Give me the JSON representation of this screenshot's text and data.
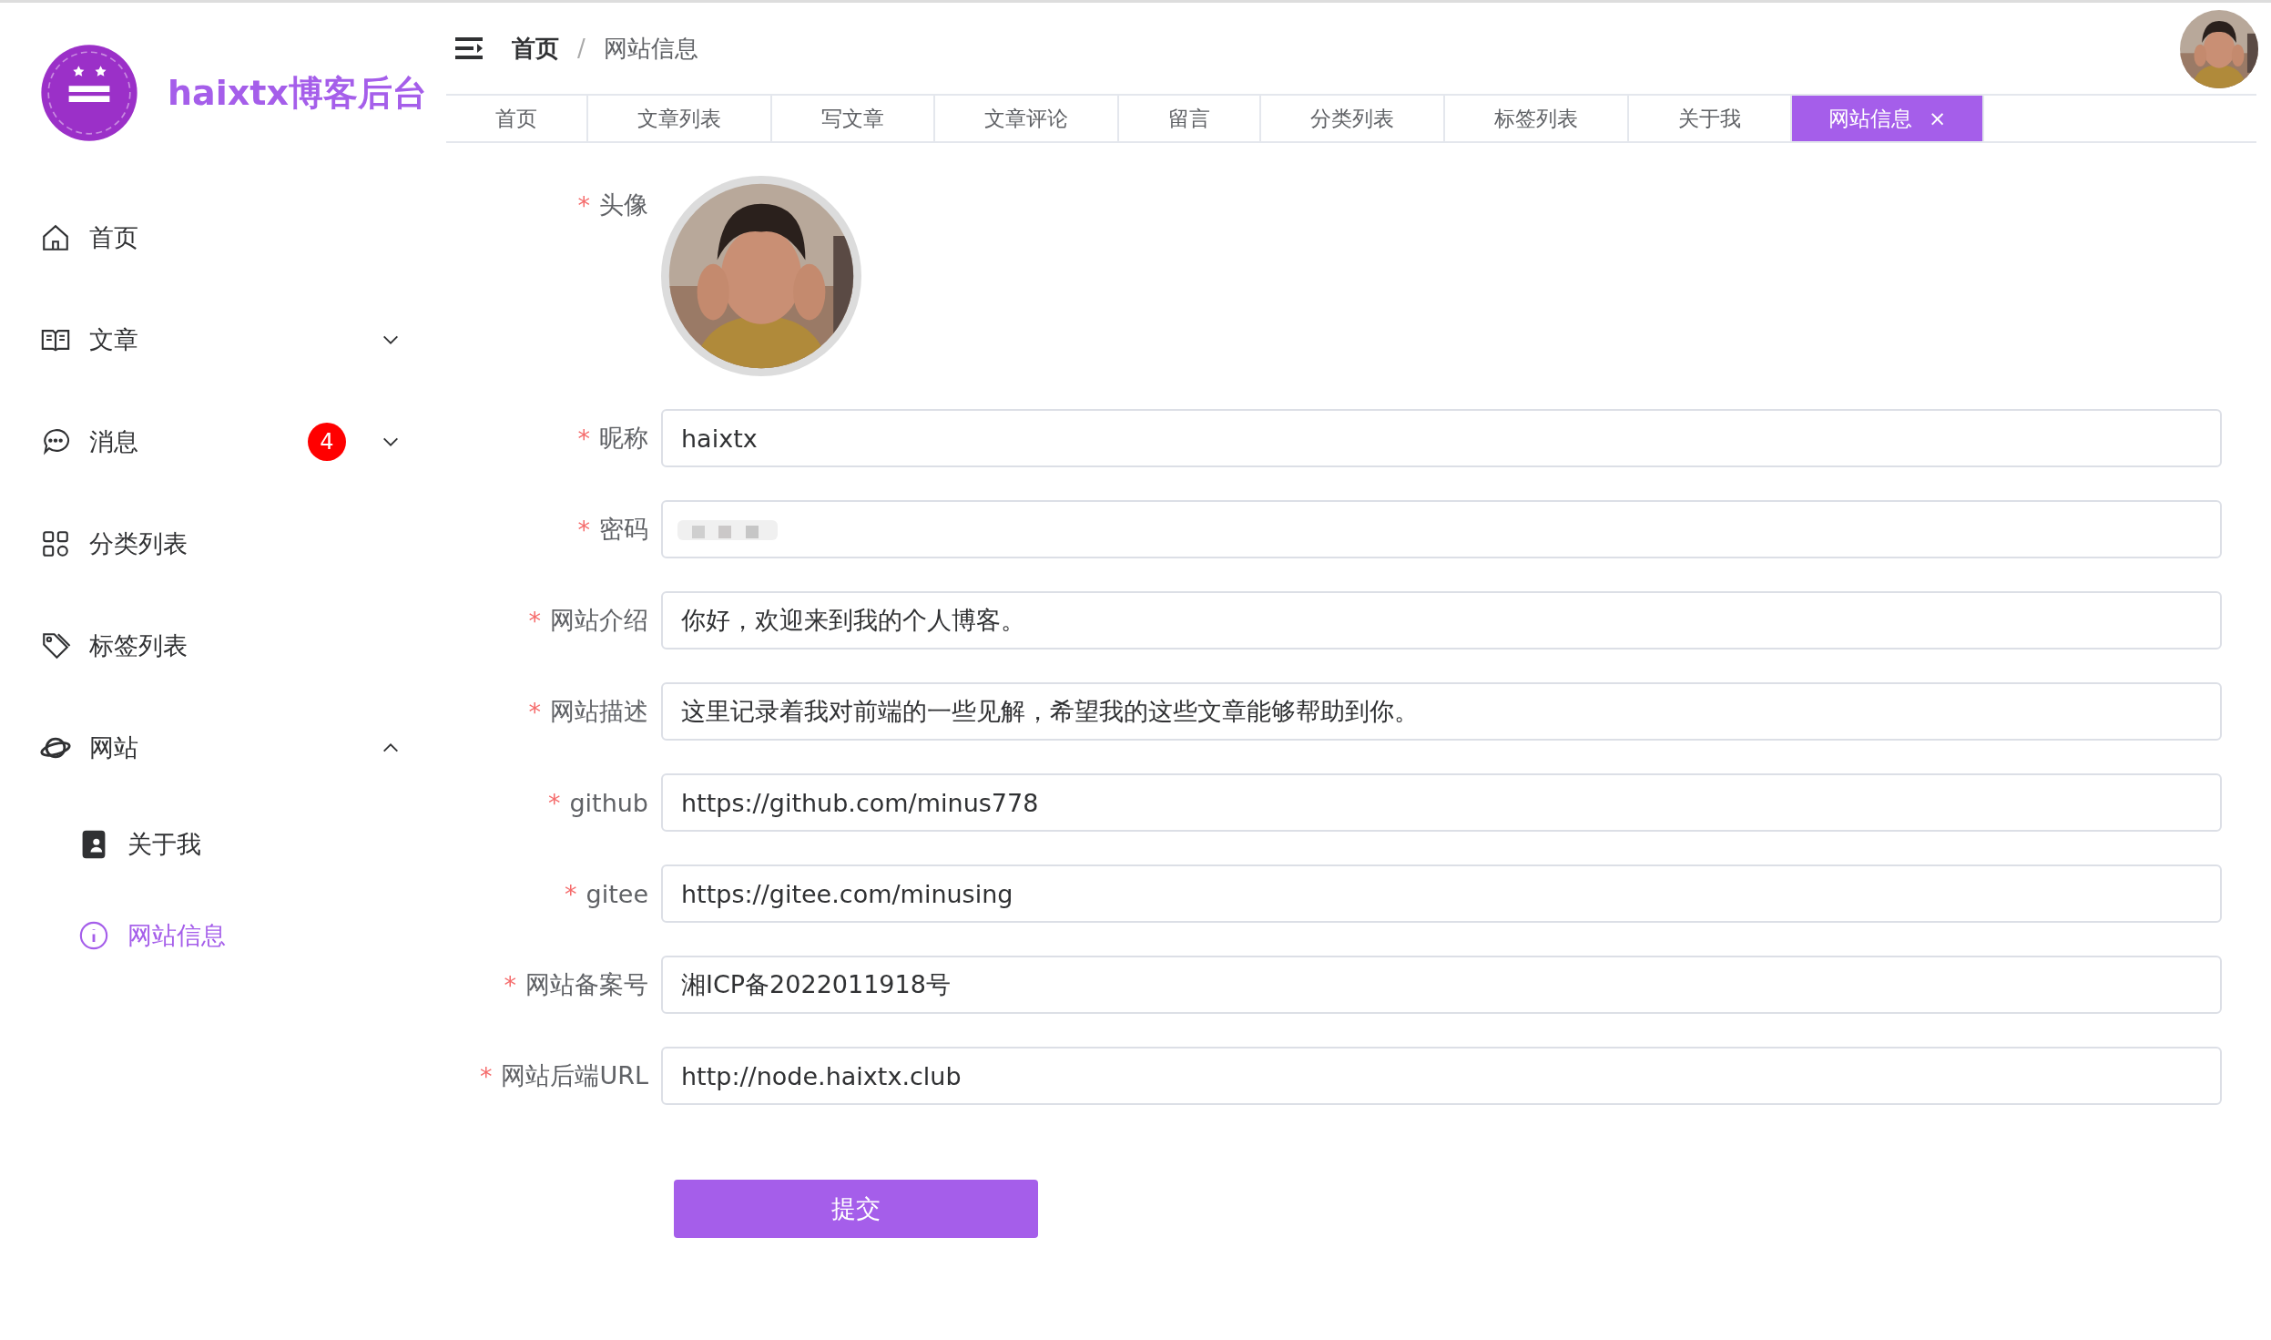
{
  "brand": {
    "title": "haixtx博客后台"
  },
  "sidebar": {
    "items": [
      {
        "label": "首页",
        "selected": false
      },
      {
        "label": "文章",
        "expanded": false,
        "selected": false
      },
      {
        "label": "消息",
        "badge": "4",
        "expanded": false,
        "selected": false
      },
      {
        "label": "分类列表",
        "selected": false
      },
      {
        "label": "标签列表",
        "selected": false
      },
      {
        "label": "网站",
        "expanded": true,
        "selected": false,
        "children": [
          {
            "label": "关于我",
            "selected": false
          },
          {
            "label": "网站信息",
            "selected": true
          }
        ]
      }
    ]
  },
  "breadcrumb": {
    "separator": "/",
    "items": [
      "首页",
      "网站信息"
    ]
  },
  "tabs": [
    {
      "label": "首页",
      "selected": false
    },
    {
      "label": "文章列表",
      "selected": false
    },
    {
      "label": "写文章",
      "selected": false
    },
    {
      "label": "文章评论",
      "selected": false
    },
    {
      "label": "留言",
      "selected": false
    },
    {
      "label": "分类列表",
      "selected": false
    },
    {
      "label": "标签列表",
      "selected": false
    },
    {
      "label": "关于我",
      "selected": false
    },
    {
      "label": "网站信息",
      "selected": true,
      "close": "×"
    }
  ],
  "form": {
    "fields": [
      {
        "kind": "avatar",
        "required_mark": "*",
        "label": "头像"
      },
      {
        "kind": "text",
        "required_mark": "*",
        "label": "昵称",
        "value": "haixtx"
      },
      {
        "kind": "blurred",
        "required_mark": "*",
        "label": "密码"
      },
      {
        "kind": "text",
        "required_mark": "*",
        "label": "网站介绍",
        "value": "你好，欢迎来到我的个人博客。"
      },
      {
        "kind": "text",
        "required_mark": "*",
        "label": "网站描述",
        "value": "这里记录着我对前端的一些见解，希望我的这些文章能够帮助到你。"
      },
      {
        "kind": "text",
        "required_mark": "*",
        "label": "github",
        "value": "https://github.com/minus778"
      },
      {
        "kind": "text",
        "required_mark": "*",
        "label": "gitee",
        "value": "https://gitee.com/minusing"
      },
      {
        "kind": "text",
        "required_mark": "*",
        "label": "网站备案号",
        "value": "湘ICP备2022011918号"
      },
      {
        "kind": "text",
        "required_mark": "*",
        "label": "网站后端URL",
        "value": "http://node.haixtx.club"
      }
    ],
    "submit": "提交"
  }
}
